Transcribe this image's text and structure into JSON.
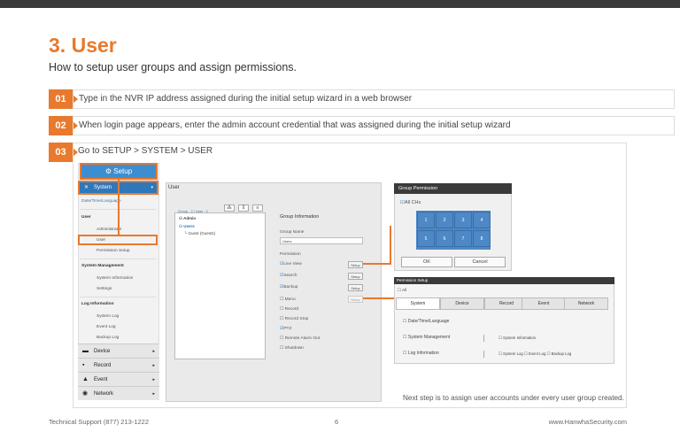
{
  "header": {
    "title_num": "3.",
    "title_word": "User",
    "subtitle": "How to setup user groups and assign permissions."
  },
  "steps": [
    {
      "num": "01",
      "text": "Type in the NVR IP address assigned during the initial setup wizard in a web browser"
    },
    {
      "num": "02",
      "text": "When login page appears, enter the admin account credential that was assigned during the initial setup wizard"
    },
    {
      "num": "03",
      "text": "Go to SETUP > SYSTEM > USER"
    }
  ],
  "sidebar": {
    "setup_label": "Setup",
    "system_label": "System",
    "date_time": "Date/Time/Language",
    "user_section": "User",
    "administrator": "Administrator",
    "user": "User",
    "permission_setup": "Permission Setup",
    "system_mgmt": "System Management",
    "system_info": "System Information",
    "settings": "Settings",
    "log_info": "Log Information",
    "system_log": "System Log",
    "event_log": "Event Log",
    "backup_log": "Backup Log",
    "device": "Device",
    "record": "Record",
    "event": "Event",
    "network": "Network"
  },
  "user_panel": {
    "title": "User",
    "group_count": "Group : 2 / User : 1",
    "tree_admin": "Admin",
    "tree_users": "Users",
    "tree_guest": "Guest (Guest1)",
    "group_info": "Group Information",
    "group_name_label": "Group Name",
    "group_name_value": "Users",
    "permission_label": "Permission",
    "perm_live": "Live View",
    "perm_search": "Search",
    "perm_backup": "Backup",
    "perm_menu": "Menu",
    "perm_record": "Record",
    "perm_record_stop": "Record Stop",
    "perm_ptz": "PTZ",
    "perm_remote_alarm": "Remote Alarm Out",
    "perm_shutdown": "Shutdown",
    "setup_btn": "Setup"
  },
  "group_permission": {
    "title": "Group Permission",
    "all_chs": "All CHs",
    "channels": [
      "1",
      "2",
      "3",
      "4",
      "5",
      "6",
      "7",
      "8"
    ],
    "ok": "OK",
    "cancel": "Cancel"
  },
  "permission_setup": {
    "title": "Permission Setup",
    "all": "All",
    "tabs": [
      "System",
      "Device",
      "Record",
      "Event",
      "Network"
    ],
    "row1": "Date/Time/Language",
    "row2": "System Management",
    "row2_sub": "System Information",
    "row3": "Log Information",
    "row3_sub1": "System Log",
    "row3_sub2": "Event Log",
    "row3_sub3": "Backup Log"
  },
  "note": "Next step is to assign user accounts under every user group created.",
  "footer": {
    "left": "Technical Support (877) 213-1222",
    "page": "6",
    "right": "www.HanwhaSecurity.com"
  },
  "colors": {
    "accent": "#e8792d",
    "blue": "#2e77bb",
    "dark": "#3a3a3c"
  }
}
